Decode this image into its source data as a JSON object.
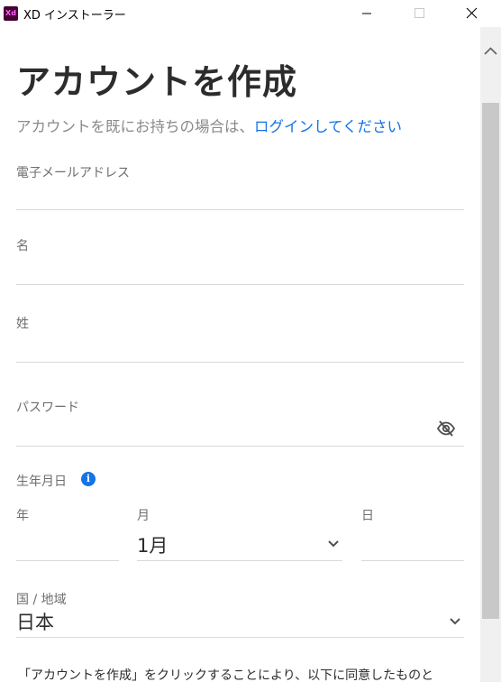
{
  "window": {
    "app_icon_text": "Xd",
    "title": "XD インストーラー"
  },
  "form": {
    "title": "アカウントを作成",
    "login_prompt": "アカウントを既にお持ちの場合は、",
    "login_link": "ログインしてください",
    "email_label": "電子メールアドレス",
    "first_name_label": "名",
    "last_name_label": "姓",
    "password_label": "パスワード",
    "birthdate_label": "生年月日",
    "year_label": "年",
    "month_label": "月",
    "month_value": "1月",
    "day_label": "日",
    "country_label": "国 / 地域",
    "country_value": "日本",
    "terms_text": "「アカウントを作成」をクリックすることにより、以下に同意したものと"
  },
  "colors": {
    "accent": "#1473e6",
    "label": "#6e6e6e",
    "line": "#d9d9d9",
    "xd_icon_bg": "#470137",
    "xd_icon_fg": "#ff61f6"
  },
  "icons": {
    "minimize": "minimize-icon",
    "maximize": "maximize-icon",
    "close": "close-icon",
    "info": "info-icon",
    "password_visibility": "eye-off-icon",
    "dropdown": "chevron-down-icon",
    "scroll_up": "chevron-up-icon"
  }
}
